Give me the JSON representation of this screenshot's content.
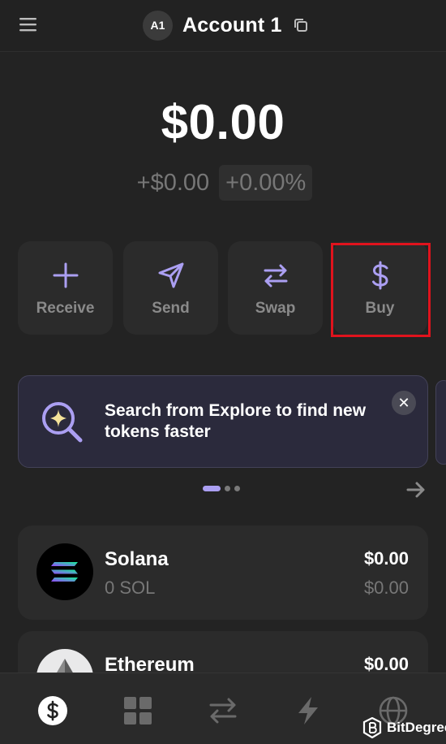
{
  "header": {
    "avatar_initials": "A1",
    "account_name": "Account 1"
  },
  "balance": {
    "total": "$0.00",
    "change_amount": "+$0.00",
    "change_percent": "+0.00%"
  },
  "actions": [
    {
      "label": "Receive",
      "icon": "plus-icon"
    },
    {
      "label": "Send",
      "icon": "send-icon"
    },
    {
      "label": "Swap",
      "icon": "swap-icon"
    },
    {
      "label": "Buy",
      "icon": "dollar-icon"
    }
  ],
  "banner": {
    "text": "Search from Explore to find new tokens faster",
    "icon": "explore-search-icon",
    "close_symbol": "✕"
  },
  "pager": {
    "pages": 3,
    "active_index": 0
  },
  "tokens": [
    {
      "name": "Solana",
      "amount": "0 SOL",
      "value": "$0.00",
      "value_change": "$0.00"
    },
    {
      "name": "Ethereum",
      "amount": "",
      "value": "$0.00",
      "value_change": ""
    }
  ],
  "bottom_nav": [
    {
      "name": "wallet-tab",
      "icon": "dollar-circle-icon",
      "active": true
    },
    {
      "name": "collectibles-tab",
      "icon": "grid-icon",
      "active": false
    },
    {
      "name": "swapper-tab",
      "icon": "swap-arrows-icon",
      "active": false
    },
    {
      "name": "activity-tab",
      "icon": "lightning-icon",
      "active": false
    },
    {
      "name": "explore-tab",
      "icon": "globe-icon",
      "active": false
    }
  ],
  "watermark": {
    "text": "BitDegree"
  },
  "colors": {
    "background": "#232323",
    "card": "#2b2b2b",
    "accent": "#ab9ff2",
    "muted_text": "#777777",
    "highlight_box": "#e0131d"
  }
}
